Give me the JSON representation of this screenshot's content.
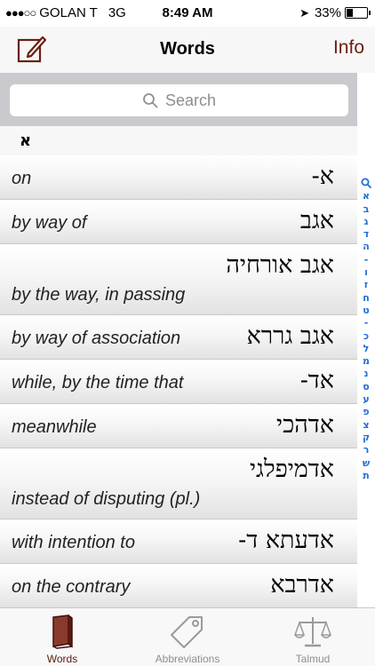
{
  "status_bar": {
    "signal": "●●●○○",
    "carrier": "GOLAN T",
    "network": "3G",
    "time": "8:49 AM",
    "battery": "33%",
    "battery_level": 0.33
  },
  "nav": {
    "title": "Words",
    "info_label": "Info",
    "edit_icon": "compose-icon"
  },
  "search": {
    "placeholder": "Search"
  },
  "section_header": "א",
  "entries": [
    {
      "hebrew": "א-",
      "english": "on"
    },
    {
      "hebrew": "אגב",
      "english": "by way of"
    },
    {
      "hebrew": "אגב אורחיה",
      "english": "by the way, in passing"
    },
    {
      "hebrew": "אגב גררא",
      "english": "by way of association"
    },
    {
      "hebrew": "אד-",
      "english": "while, by the time that"
    },
    {
      "hebrew": "אדהכי",
      "english": "meanwhile"
    },
    {
      "hebrew": "אדמיפלגי",
      "english": "instead of disputing (pl.)"
    },
    {
      "hebrew": "אדעתא ד-",
      "english": "with intention to"
    },
    {
      "hebrew": "אדרבא",
      "english": "on the contrary"
    }
  ],
  "index_letters": [
    "א",
    "ב",
    "ג",
    "ד",
    "ה",
    "-",
    "ו",
    "ז",
    "ח",
    "ט",
    "-",
    "כ",
    "ל",
    "מ",
    "נ",
    "ס",
    "ע",
    "פ",
    "צ",
    "ק",
    "ר",
    "ש",
    "ת"
  ],
  "tabs": [
    {
      "label": "Words",
      "icon": "book-icon",
      "active": true
    },
    {
      "label": "Abbreviations",
      "icon": "tag-icon",
      "active": false
    },
    {
      "label": "Talmud",
      "icon": "scales-icon",
      "active": false
    }
  ],
  "colors": {
    "accent": "#6b1f12",
    "index_blue": "#1e6fd9",
    "search_bar_bg": "#c9c9ce"
  }
}
